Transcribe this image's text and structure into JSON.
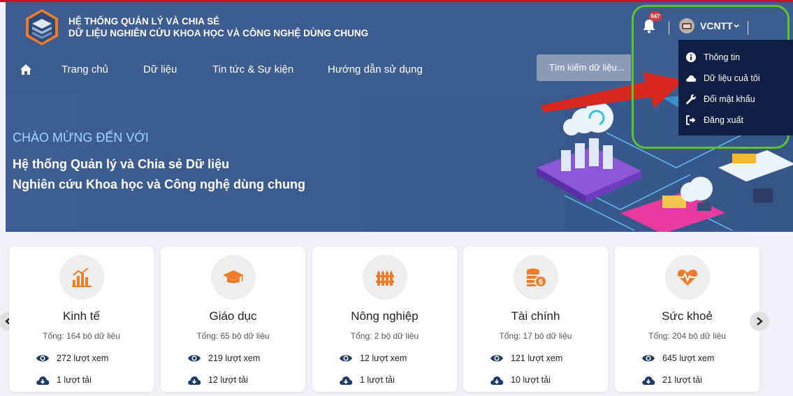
{
  "header": {
    "title_line1": "HỆ THỐNG QUẢN LÝ VÀ CHIA SẺ",
    "title_line2": "DỮ LIỆU NGHIÊN CỨU KHOA HỌC VÀ CÔNG NGHỆ DÙNG CHUNG",
    "notification_count": "947",
    "user_name": "VCNTT"
  },
  "nav": {
    "items": [
      {
        "label": "Trang chủ"
      },
      {
        "label": "Dữ liệu"
      },
      {
        "label": "Tin tức & Sự kiện"
      },
      {
        "label": "Hướng dẫn sử dụng"
      }
    ],
    "search_placeholder": "Tìm kiếm dữ liệu..."
  },
  "user_menu": {
    "items": [
      {
        "label": "Thông tin",
        "icon": "info-icon"
      },
      {
        "label": "Dữ liệu cuả tôi",
        "icon": "cloud-icon"
      },
      {
        "label": "Đổi mật khẩu",
        "icon": "wrench-icon"
      },
      {
        "label": "Đăng xuất",
        "icon": "logout-icon"
      }
    ]
  },
  "hero": {
    "welcome": "CHÀO MỪNG ĐẾN VỚI",
    "line1": "Hệ thống Quản lý và Chia sẻ Dữ liệu",
    "line2": "Nghiên cứu Khoa học và Công nghệ dùng chung"
  },
  "categories": [
    {
      "name": "Kinh tế",
      "total": "Tổng: 164 bộ dữ liệu",
      "views": "272 lượt xem",
      "downloads": "1 lượt tải",
      "icon": "chart-icon"
    },
    {
      "name": "Giáo dục",
      "total": "Tổng: 65 bộ dữ liệu",
      "views": "219 lượt xem",
      "downloads": "12 lượt tải",
      "icon": "graduation-cap-icon"
    },
    {
      "name": "Nông nghiệp",
      "total": "Tổng: 2 bộ dữ liệu",
      "views": "12 lượt xem",
      "downloads": "1 lượt tải",
      "icon": "fence-icon"
    },
    {
      "name": "Tài chính",
      "total": "Tổng: 17 bộ dữ liệu",
      "views": "121 lượt xem",
      "downloads": "10 lượt tải",
      "icon": "coins-icon"
    },
    {
      "name": "Sức khoẻ",
      "total": "Tổng: 204 bộ dữ liệu",
      "views": "645 lượt xem",
      "downloads": "21 lượt tải",
      "icon": "heartbeat-icon"
    }
  ],
  "colors": {
    "header_bg": "#3d5c8f",
    "accent_orange": "#f07b2a",
    "dropdown_bg": "#0f1f44",
    "highlight_green": "#5cc52c",
    "arrow_red": "#d6281e",
    "card_text_dark": "#1d3a64"
  }
}
